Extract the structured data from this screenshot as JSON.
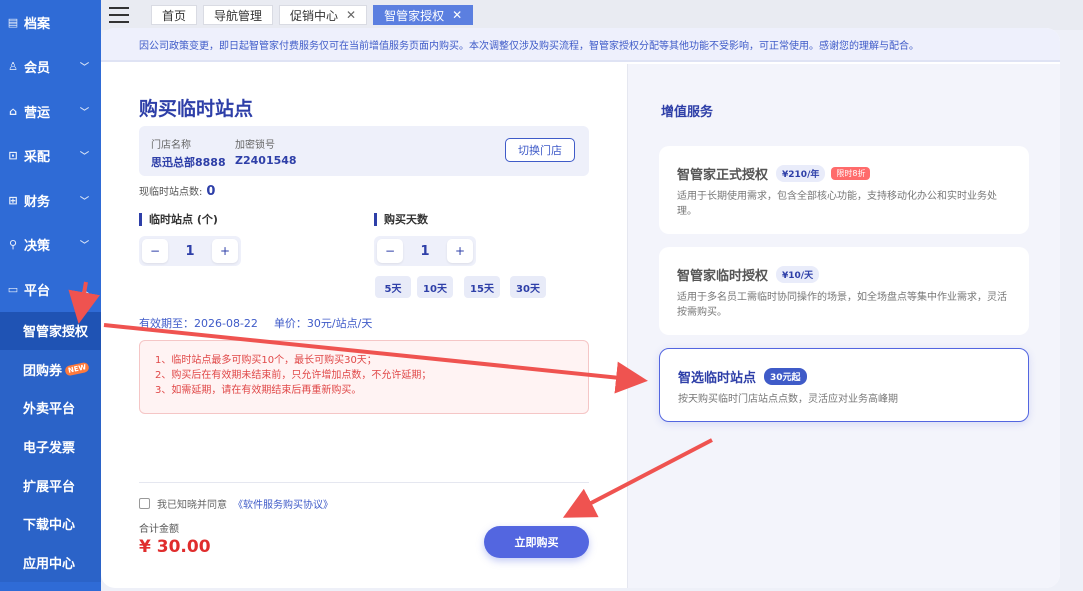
{
  "sidebar": {
    "items": [
      {
        "label": "档案",
        "icon": "archive-icon",
        "glyph": "▤"
      },
      {
        "label": "会员",
        "icon": "user-icon",
        "glyph": "♙"
      },
      {
        "label": "营运",
        "icon": "store-icon",
        "glyph": "⌂"
      },
      {
        "label": "采配",
        "icon": "cart-icon",
        "glyph": "⊡"
      },
      {
        "label": "财务",
        "icon": "finance-icon",
        "glyph": "⊞"
      },
      {
        "label": "决策",
        "icon": "decision-icon",
        "glyph": "⚲"
      },
      {
        "label": "平台",
        "icon": "platform-icon",
        "glyph": "▭"
      }
    ],
    "sub_items": [
      {
        "label": "智管家授权",
        "active": true
      },
      {
        "label": "团购券",
        "badge": "NEW"
      },
      {
        "label": "外卖平台"
      },
      {
        "label": "电子发票"
      },
      {
        "label": "扩展平台"
      },
      {
        "label": "下载中心"
      },
      {
        "label": "应用中心"
      }
    ]
  },
  "tabs": [
    {
      "label": "首页"
    },
    {
      "label": "导航管理"
    },
    {
      "label": "促销中心"
    },
    {
      "label": "智管家授权"
    }
  ],
  "notice": "因公司政策变更，即日起智管家付费服务仅可在当前增值服务页面内购买。本次调整仅涉及购买流程，智管家授权分配等其他功能不受影响，可正常使用。感谢您的理解与配合。",
  "purchase": {
    "title": "购买临时站点",
    "store_name_label": "门店名称",
    "store_name": "思迅总部8888",
    "account_label": "加密锁号",
    "account": "Z2401548",
    "switch_label": "切换门店",
    "current_count_label": "现临时站点数:",
    "current_count": "0",
    "sites_label": "临时站点 (个)",
    "sites_value": "1",
    "days_label": "购买天数",
    "days_value": "1",
    "day_options": [
      "5天",
      "10天",
      "15天",
      "30天"
    ],
    "minus": "−",
    "plus": "+",
    "valid_until": "有效期至：2026-08-22",
    "unit_price": "单价：30元/站点/天",
    "rules": [
      "1、临时站点最多可购买10个，最长可购买30天；",
      "2、购买后在有效期未结束前，只允许增加点数，不允许延期；",
      "3、如需延期，请在有效期结束后再重新购买。"
    ],
    "agree_text": "我已知晓并同意",
    "agree_link": "《软件服务购买协议》",
    "total_label": "合计金额",
    "total": "¥ 30.00",
    "buy_label": "立即购买"
  },
  "services": {
    "title": "增值服务",
    "cards": [
      {
        "name": "智管家正式授权",
        "price": "¥210/年",
        "promo": "限时8折",
        "desc": "适用于长期使用需求，包含全部核心功能，支持移动化办公和实时业务处理。",
        "selected": false
      },
      {
        "name": "智管家临时授权",
        "price": "¥10/天",
        "desc": "适用于多名员工需临时协同操作的场景，如全场盘点等集中作业需求，灵活按需购买。",
        "selected": false
      },
      {
        "name": "智选临时站点",
        "price": "30元起",
        "desc": "按天购买临时门店站点点数，灵活应对业务高峰期",
        "selected": true
      }
    ]
  },
  "colors": {
    "sidebar": "#2f6bd6",
    "accent": "#5366e0",
    "title": "#2e3fa8",
    "danger": "#e02d2d",
    "annotation_arrow": "#ef5350"
  }
}
